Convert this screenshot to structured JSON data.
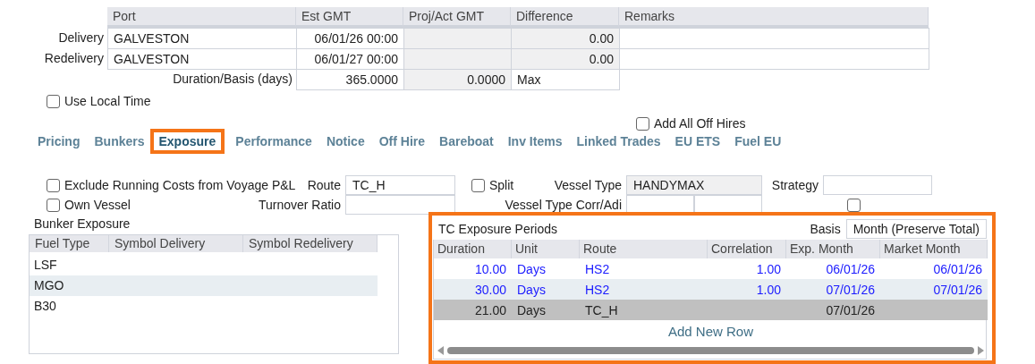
{
  "ports_table": {
    "columns": [
      "Port",
      "Est GMT",
      "Proj/Act GMT",
      "Difference",
      "Remarks"
    ],
    "rows": [
      {
        "label": "Delivery",
        "port": "GALVESTON",
        "est_gmt": "06/01/26 00:00",
        "proj_act_gmt": "",
        "difference": "0.00",
        "remarks": ""
      },
      {
        "label": "Redelivery",
        "port": "GALVESTON",
        "est_gmt": "06/01/27 00:00",
        "proj_act_gmt": "",
        "difference": "0.00",
        "remarks": ""
      }
    ],
    "duration": {
      "label": "Duration/Basis (days)",
      "value": "365.0000",
      "proj_value": "0.0000",
      "basis": "Max"
    }
  },
  "use_local_time": {
    "label": "Use Local Time",
    "checked": false
  },
  "add_all_off_hires": {
    "label": "Add All Off Hires",
    "checked": false
  },
  "tabs": [
    {
      "label": "Pricing",
      "selected": false
    },
    {
      "label": "Bunkers",
      "selected": false
    },
    {
      "label": "Exposure",
      "selected": true
    },
    {
      "label": "Performance",
      "selected": false
    },
    {
      "label": "Notice",
      "selected": false
    },
    {
      "label": "Off Hire",
      "selected": false
    },
    {
      "label": "Bareboat",
      "selected": false
    },
    {
      "label": "Inv Items",
      "selected": false
    },
    {
      "label": "Linked Trades",
      "selected": false
    },
    {
      "label": "EU ETS",
      "selected": false
    },
    {
      "label": "Fuel EU",
      "selected": false
    }
  ],
  "form": {
    "exclude_running_costs": {
      "label": "Exclude Running Costs from Voyage P&L",
      "checked": false
    },
    "own_vessel": {
      "label": "Own Vessel",
      "checked": false
    },
    "route": {
      "label": "Route",
      "value": "TC_H"
    },
    "turnover_ratio": {
      "label": "Turnover Ratio"
    },
    "split": {
      "label": "Split",
      "checked": false
    },
    "vessel_type": {
      "label": "Vessel Type",
      "value": "HANDYMAX"
    },
    "vessel_type_corr_adj": {
      "label": "Vessel Type Corr/Adi"
    },
    "strategy": {
      "label": "Strategy"
    },
    "extra_checkbox": {
      "checked": false
    }
  },
  "bunker_exposure": {
    "title": "Bunker Exposure",
    "columns": [
      "Fuel Type",
      "Symbol Delivery",
      "Symbol Redelivery"
    ],
    "rows": [
      {
        "fuel_type": "LSF"
      },
      {
        "fuel_type": "MGO"
      },
      {
        "fuel_type": "B30"
      }
    ]
  },
  "tc_exposure": {
    "title": "TC Exposure Periods",
    "basis_label": "Basis",
    "basis": "Month (Preserve Total)",
    "columns": [
      "Duration",
      "Unit",
      "Route",
      "Correlation",
      "Exp. Month",
      "Market Month"
    ],
    "rows": [
      {
        "kind": "market",
        "selected": false,
        "duration": "10.00",
        "unit": "Days",
        "route": "HS2",
        "correlation": "1.00",
        "exp_month": "06/01/26",
        "market_month": "06/01/26"
      },
      {
        "kind": "market",
        "selected": false,
        "duration": "30.00",
        "unit": "Days",
        "route": "HS2",
        "correlation": "1.00",
        "exp_month": "07/01/26",
        "market_month": "07/01/26"
      },
      {
        "kind": "plain",
        "selected": true,
        "duration": "21.00",
        "unit": "Days",
        "route": "TC_H",
        "correlation": "",
        "exp_month": "07/01/26",
        "market_month": ""
      }
    ],
    "add_row": "Add New Row"
  }
}
